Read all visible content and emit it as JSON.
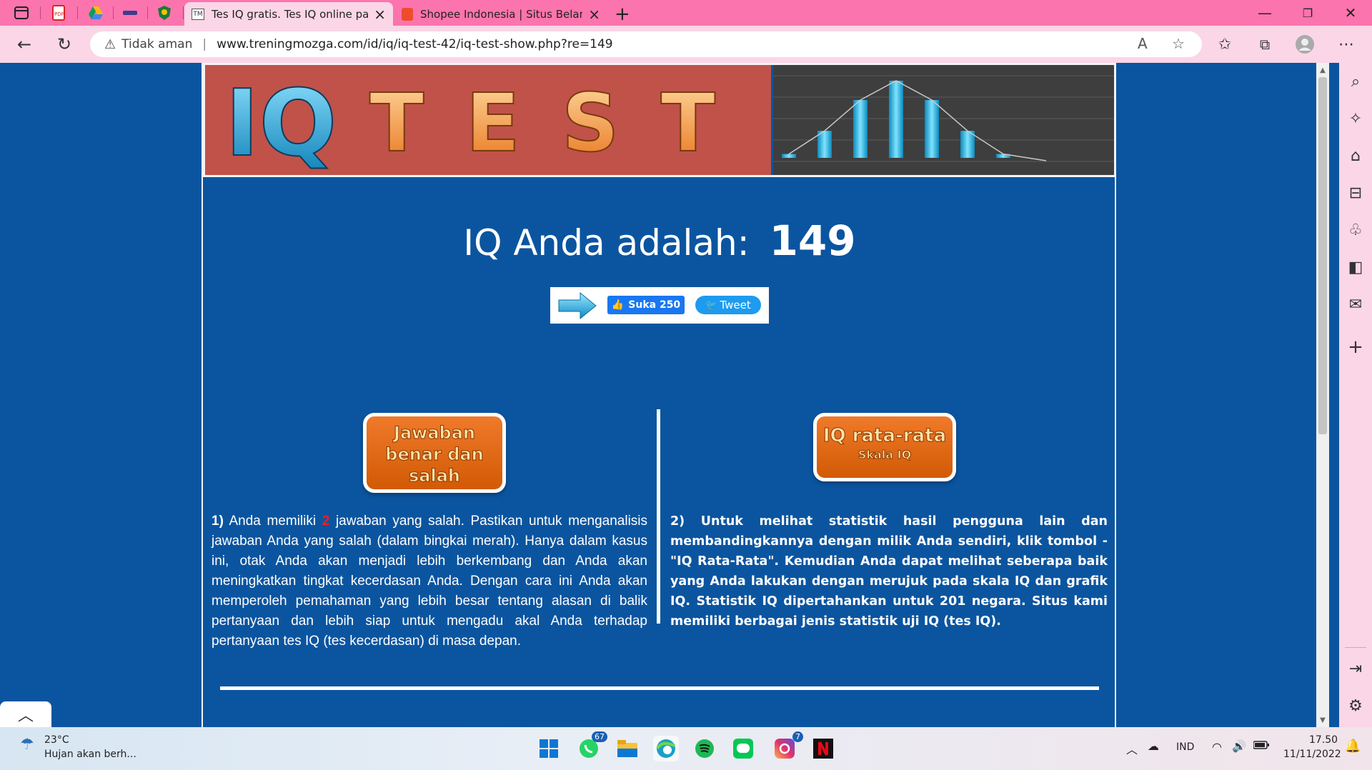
{
  "browser": {
    "tabs": [
      {
        "title": "Tes IQ gratis. Tes IQ online paling",
        "active": true
      },
      {
        "title": "Shopee Indonesia | Situs Belanja",
        "active": false
      }
    ],
    "pinned_icons": [
      "tab-actions-icon",
      "pdf-icon",
      "drive-icon",
      "extension-icon",
      "shield-icon"
    ],
    "address": {
      "security_label": "Tidak aman",
      "url": "www.treningmozga.com/id/iq/iq-test-42/iq-test-show.php?re=149"
    },
    "window_controls": {
      "minimize": "—",
      "restore": "❐",
      "close": "✕"
    }
  },
  "banner": {
    "logo_text_iq": "IQ",
    "logo_text_test": "TEST"
  },
  "result": {
    "label": "IQ Anda adalah:",
    "value": "149"
  },
  "share": {
    "like_label": "Suka 250",
    "tweet_label": "Tweet"
  },
  "buttons": {
    "answers_label": "Jawaban benar dan salah",
    "average_label": "IQ rata-rata",
    "average_sub": "Skala IQ"
  },
  "paragraph1": {
    "number": "1)",
    "lead": "Anda memiliki",
    "wrong_count": "2",
    "rest": "jawaban yang salah. Pastikan untuk menganalisis jawaban Anda yang salah (dalam bingkai merah). Hanya dalam kasus ini, otak Anda akan menjadi lebih berkembang dan Anda akan meningkatkan tingkat kecerdasan Anda. Dengan cara ini Anda akan memperoleh pemahaman yang lebih besar tentang alasan di balik pertanyaan dan lebih siap untuk mengadu akal Anda terhadap pertanyaan tes IQ (tes kecerdasan) di masa depan."
  },
  "paragraph2": {
    "number": "2)",
    "text": "Untuk melihat statistik hasil pengguna lain dan membandingkannya dengan milik Anda sendiri, klik tombol - \"IQ Rata-Rata\". Kemudian Anda dapat melihat seberapa baik yang Anda lakukan dengan merujuk pada skala IQ dan grafik IQ. Statistik IQ dipertahankan untuk 201 negara. Situs kami memiliki berbagai jenis statistik uji IQ (tes IQ)."
  },
  "chart_data": {
    "type": "bar",
    "values": [
      0.05,
      0.35,
      0.75,
      1.0,
      0.75,
      0.35,
      0.05
    ]
  },
  "taskbar": {
    "weather_temp": "23°C",
    "weather_desc": "Hujan akan berh...",
    "whatsapp_badge": "67",
    "instagram_badge": "7",
    "language": "IND",
    "time": "17.50",
    "date": "11/11/2022"
  },
  "colors": {
    "tab_strip": "#fc74ad",
    "page_bg": "#0b55a0",
    "banner_left": "#c0524a",
    "button_orange": "#e06a14"
  }
}
